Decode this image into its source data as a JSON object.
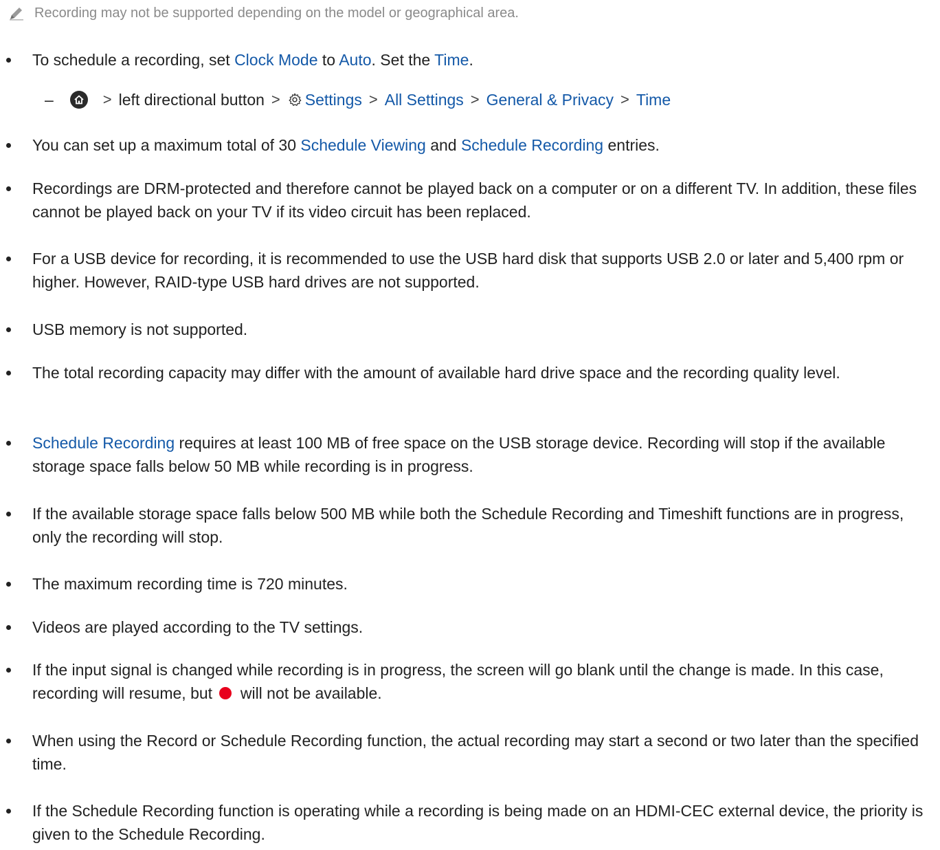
{
  "note": {
    "icon": "pencil-note-icon",
    "text": "Recording may not be supported depending on the model or geographical area."
  },
  "items": [
    {
      "p1": "To schedule a recording, set ",
      "l1": "Clock Mode",
      "p2": " to ",
      "l2": "Auto",
      "p3": ". Set the ",
      "l3": "Time",
      "p4": "."
    },
    {
      "p1": "You can set up a maximum total of 30 ",
      "l1": "Schedule Viewing",
      "p2": " and ",
      "l2": "Schedule Recording",
      "p3": " entries."
    },
    {
      "text": "Recordings are DRM-protected and therefore cannot be played back on a computer or on a different TV. In addition, these files cannot be played back on your TV if its video circuit has been replaced."
    },
    {
      "text": "For a USB device for recording, it is recommended to use the USB hard disk that supports USB 2.0 or later and 5,400 rpm or higher. However, RAID-type USB hard drives are not supported."
    },
    {
      "text": "USB memory is not supported."
    },
    {
      "text": "The total recording capacity may differ with the amount of available hard drive space and the recording quality level."
    },
    {
      "l1": "Schedule Recording",
      "p1": " requires at least 100 MB of free space on the USB storage device. Recording will stop if the available storage space falls below 50 MB while recording is in progress."
    },
    {
      "text": "If the available storage space falls below 500 MB while both the Schedule Recording and Timeshift functions are in progress, only the recording will stop."
    },
    {
      "text": "The maximum recording time is 720 minutes."
    },
    {
      "text": "Videos are played according to the TV settings."
    },
    {
      "p1": "If the input signal is changed while recording is in progress, the screen will go blank until the change is made. In this case, recording will resume, but ",
      "p2": " will not be available."
    },
    {
      "text": "When using the Record or Schedule Recording function, the actual recording may start a second or two later than the specified time."
    },
    {
      "text": "If the Schedule Recording function is operating while a recording is being made on an HDMI-CEC external device, the priority is given to the Schedule Recording."
    }
  ],
  "path": {
    "dash": "–",
    "home_icon": "home-icon",
    "step1": "left directional button",
    "settings_icon": "gear-icon",
    "step2": "Settings",
    "step3": "All Settings",
    "step4": "General & Privacy",
    "step5": "Time",
    "separator_icon": "chevron-right-icon",
    "sep": ">"
  },
  "colors": {
    "link": "#1459a8",
    "record": "#e8001c",
    "note": "#8a8a8a",
    "text": "#222222"
  }
}
